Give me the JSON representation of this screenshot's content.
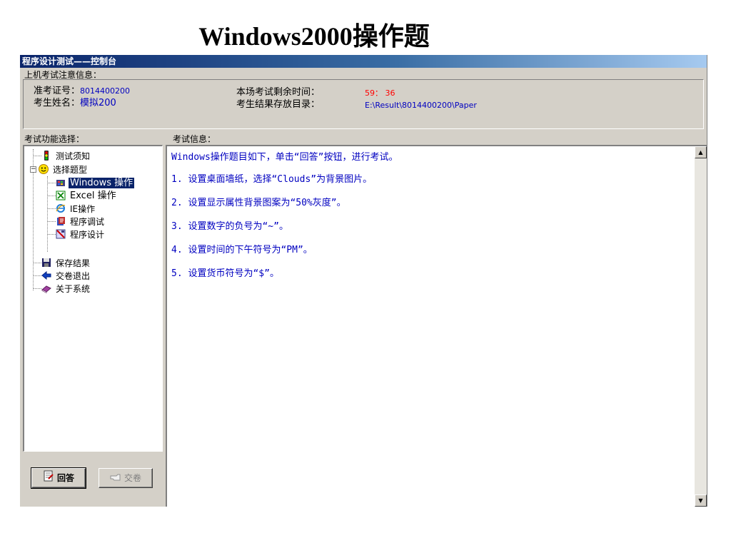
{
  "slide_title": "Windows2000操作题",
  "window": {
    "title": "程序设计测试——控制台",
    "notice_header": "上机考试注意信息：",
    "exam_id_label": "准考证号：",
    "exam_id_value": "8014400200",
    "name_label": "考生姓名：",
    "name_value": "模拟200",
    "time_label": "本场考试剩余时间：",
    "time_value": "59： 36",
    "dir_label": "考生结果存放目录：",
    "dir_value": "E:\\Result\\8014400200\\Paper"
  },
  "function_header": "考试功能选择：",
  "exam_info_header": "考试信息：",
  "tree": {
    "items": [
      {
        "label": "测试须知",
        "icon": "traffic-light-icon"
      },
      {
        "label": "选择题型",
        "icon": "smiley-icon"
      },
      {
        "label": "Windows 操作",
        "icon": "windows-icon"
      },
      {
        "label": "Excel 操作",
        "icon": "excel-icon"
      },
      {
        "label": "IE操作",
        "icon": "ie-icon"
      },
      {
        "label": "程序调试",
        "icon": "debug-icon"
      },
      {
        "label": "程序设计",
        "icon": "design-icon"
      },
      {
        "label": "保存结果",
        "icon": "floppy-icon"
      },
      {
        "label": "交卷退出",
        "icon": "exit-arrow-icon"
      },
      {
        "label": "关于系统",
        "icon": "book-icon"
      }
    ]
  },
  "buttons": {
    "answer": "回答",
    "submit": "交卷"
  },
  "content": {
    "lines": [
      "Windows操作题目如下，单击“回答”按钮，进行考试。",
      "1. 设置桌面墙纸，选择“Clouds”为背景图片。",
      "2. 设置显示属性背景图案为“50%灰度”。",
      "3. 设置数字的负号为“~”。",
      "4. 设置时间的下午符号为“PM”。",
      "5. 设置货币符号为“$”。"
    ]
  },
  "colors": {
    "title_bar_start": "#0a246a",
    "title_bar_end": "#a6caf0",
    "text_blue": "#0000c0",
    "text_red": "#ff0000",
    "selection": "#0a246a"
  }
}
